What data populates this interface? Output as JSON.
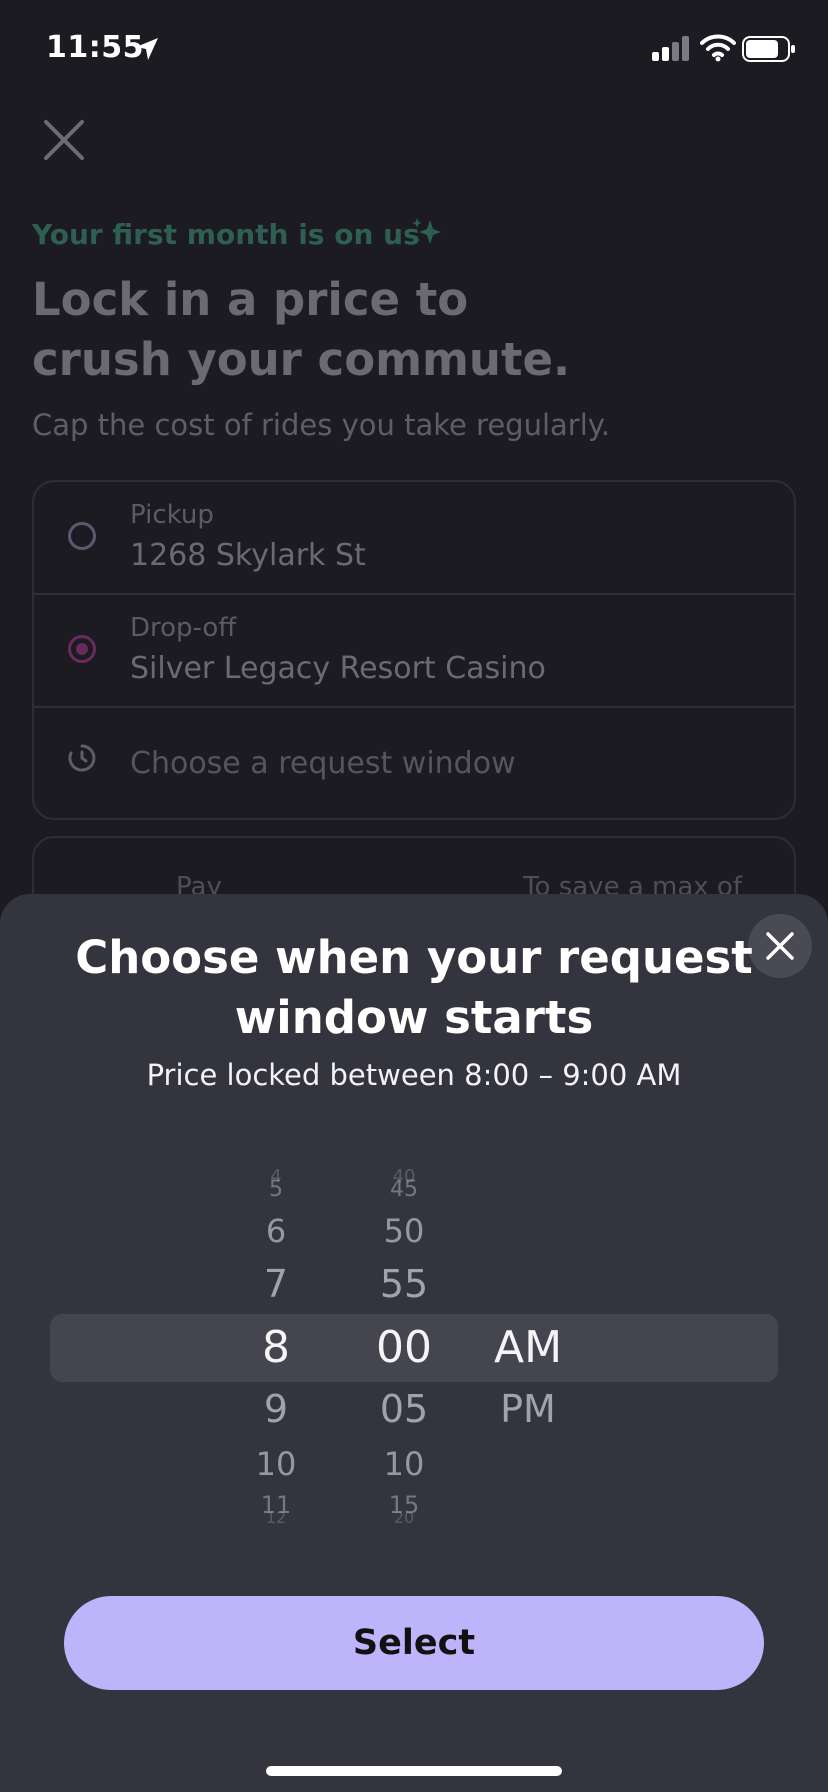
{
  "status_bar": {
    "time": "11:55"
  },
  "background": {
    "promo": "Your first month is on us",
    "headline": "Lock in a price to crush your commute.",
    "subline": "Cap the cost of rides you take regularly.",
    "pickup": {
      "label": "Pickup",
      "value": "1268 Skylark St"
    },
    "dropoff": {
      "label": "Drop-off",
      "value": "Silver Legacy Resort Casino"
    },
    "request_window": {
      "placeholder": "Choose a request window"
    },
    "pay": {
      "label": "Pay",
      "save_label": "To save a max of"
    }
  },
  "sheet": {
    "title": "Choose when your request window starts",
    "subtitle": "Price locked between 8:00 – 9:00 AM",
    "picker": {
      "hours": [
        "4",
        "5",
        "6",
        "7",
        "8",
        "9",
        "10",
        "11",
        "12"
      ],
      "minutes": [
        "40",
        "45",
        "50",
        "55",
        "00",
        "05",
        "10",
        "15",
        "20"
      ],
      "ampm": [
        "AM",
        "PM"
      ],
      "selected": {
        "hour": "8",
        "minute": "00",
        "ampm": "AM"
      }
    },
    "select_label": "Select"
  },
  "colors": {
    "accent": "#bdb4fb",
    "sheet_bg": "#34343e",
    "page_bg": "#1b1b21",
    "promo": "#2f5f52"
  }
}
